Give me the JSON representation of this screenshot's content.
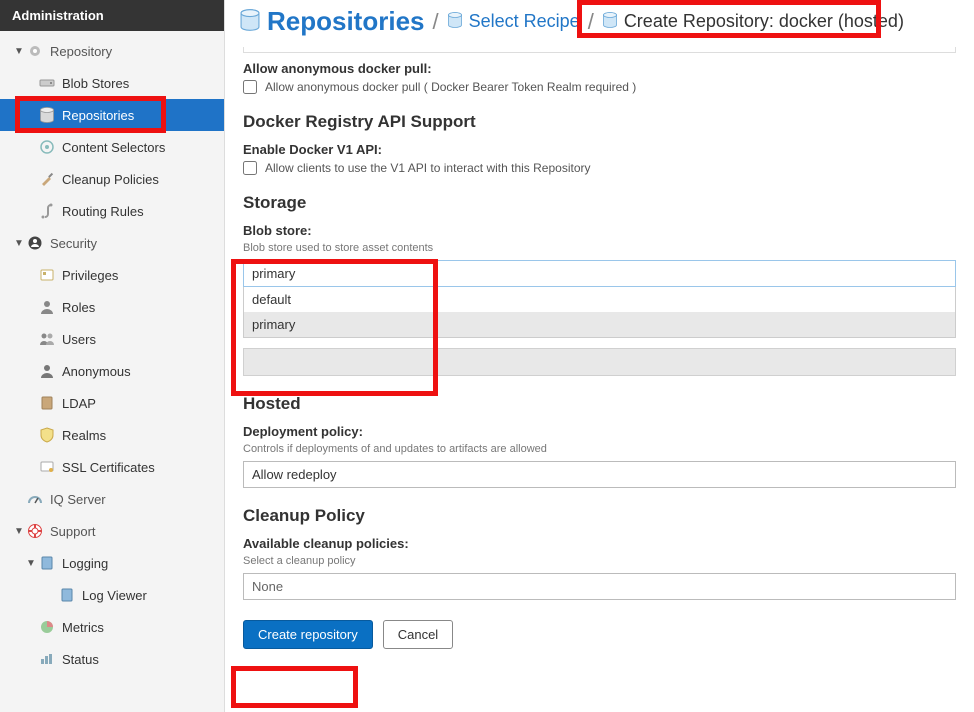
{
  "sidebar": {
    "header": "Administration",
    "groups": [
      {
        "label": "Repository",
        "items": [
          {
            "label": "Blob Stores"
          },
          {
            "label": "Repositories",
            "active": true
          },
          {
            "label": "Content Selectors"
          },
          {
            "label": "Cleanup Policies"
          },
          {
            "label": "Routing Rules"
          }
        ]
      },
      {
        "label": "Security",
        "items": [
          {
            "label": "Privileges"
          },
          {
            "label": "Roles"
          },
          {
            "label": "Users"
          },
          {
            "label": "Anonymous"
          },
          {
            "label": "LDAP"
          },
          {
            "label": "Realms"
          },
          {
            "label": "SSL Certificates"
          }
        ]
      },
      {
        "label": "IQ Server",
        "leaf": true
      },
      {
        "label": "Support",
        "items": [
          {
            "label": "Logging",
            "children": [
              {
                "label": "Log Viewer"
              }
            ]
          },
          {
            "label": "Metrics"
          },
          {
            "label": "Status"
          }
        ]
      }
    ]
  },
  "breadcrumb": {
    "title": "Repositories",
    "recipe": "Select Recipe",
    "current": "Create Repository: docker (hosted)"
  },
  "form": {
    "anon": {
      "label": "Allow anonymous docker pull:",
      "checkbox": "Allow anonymous docker pull ( Docker Bearer Token Realm required )"
    },
    "api": {
      "heading": "Docker Registry API Support",
      "label": "Enable Docker V1 API:",
      "checkbox": "Allow clients to use the V1 API to interact with this Repository"
    },
    "storage": {
      "heading": "Storage",
      "label": "Blob store:",
      "desc": "Blob store used to store asset contents",
      "selected": "primary",
      "options": [
        "default",
        "primary"
      ]
    },
    "hosted": {
      "heading": "Hosted",
      "label": "Deployment policy:",
      "desc": "Controls if deployments of and updates to artifacts are allowed",
      "value": "Allow redeploy"
    },
    "cleanup": {
      "heading": "Cleanup Policy",
      "label": "Available cleanup policies:",
      "desc": "Select a cleanup policy",
      "value": "None"
    },
    "actions": {
      "create": "Create repository",
      "cancel": "Cancel"
    }
  }
}
